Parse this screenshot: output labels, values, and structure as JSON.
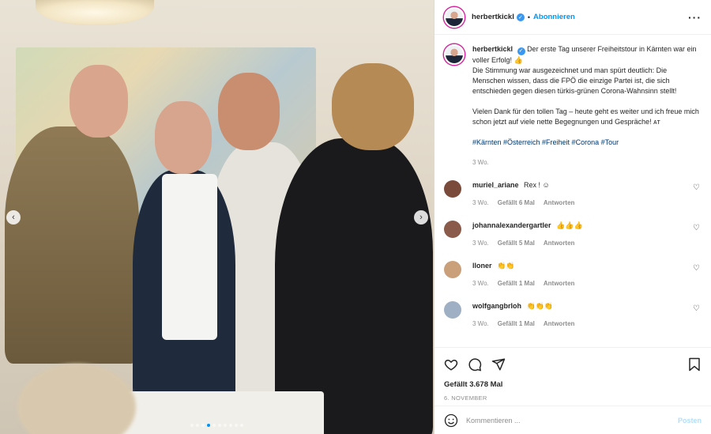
{
  "post": {
    "username": "herbertkickl",
    "verified_icon": "verified-badge-icon",
    "follow_label": "Abonnieren",
    "header_separator": "•",
    "more_icon": "more-horizontal-icon",
    "more_glyph": "···"
  },
  "caption": {
    "username": "herbertkickl",
    "text": "Der erste Tag unserer Freiheitstour in Kärnten war ein voller Erfolg! 👍\nDie Stimmung war ausgezeichnet und man spürt deutlich: Die Menschen wissen, dass die FPÖ die einzige Partei ist, die sich entschieden gegen diesen türkis-grünen Corona-Wahnsinn stellt!\n\nVielen Dank für den tollen Tag – heute geht es weiter und ich freue mich schon jetzt auf viele nette Begegnungen und Gespräche! ᴀᴛ",
    "hashtags": "#Kärnten #Österreich #Freiheit #Corona #Tour",
    "time": "3 Wo."
  },
  "comments": [
    {
      "username": "muriel_ariane",
      "text": "Rex ! ☺",
      "time": "3 Wo.",
      "likes": "Gefällt 6 Mal",
      "reply": "Antworten",
      "avatar_color": "#7a4a3a"
    },
    {
      "username": "johannalexandergartler",
      "text": "👍👍👍",
      "time": "3 Wo.",
      "likes": "Gefällt 5 Mal",
      "reply": "Antworten",
      "avatar_color": "#8a5a4a"
    },
    {
      "username": "lloner",
      "text": "👏👏",
      "time": "3 Wo.",
      "likes": "Gefällt 1 Mal",
      "reply": "Antworten",
      "avatar_color": "#c9a07a"
    },
    {
      "username": "wolfgangbrloh",
      "text": "👏👏👏",
      "time": "3 Wo.",
      "likes": "Gefällt 1 Mal",
      "reply": "Antworten",
      "avatar_color": "#9fb0c4"
    }
  ],
  "actions": {
    "like_icon": "heart-icon",
    "comment_icon": "comment-icon",
    "share_icon": "send-icon",
    "save_icon": "bookmark-icon",
    "likes_text": "Gefällt 3.678 Mal",
    "date_text": "6. NOVEMBER"
  },
  "composer": {
    "emoji_icon": "emoji-icon",
    "placeholder": "Kommentieren ...",
    "post_label": "Posten"
  },
  "carousel": {
    "prev_glyph": "‹",
    "next_glyph": "›",
    "slide_count": 10,
    "active_slide": 3
  },
  "colors": {
    "accent": "#0095f6",
    "link": "#00376b",
    "muted": "#8e8e8e"
  }
}
